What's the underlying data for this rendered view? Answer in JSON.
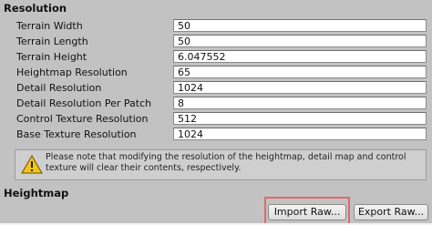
{
  "resolution": {
    "title": "Resolution",
    "rows": [
      {
        "label": "Terrain Width",
        "value": "50"
      },
      {
        "label": "Terrain Length",
        "value": "50"
      },
      {
        "label": "Terrain Height",
        "value": "6.047552"
      },
      {
        "label": "Heightmap Resolution",
        "value": "65"
      },
      {
        "label": "Detail Resolution",
        "value": "1024"
      },
      {
        "label": "Detail Resolution Per Patch",
        "value": "8"
      },
      {
        "label": "Control Texture Resolution",
        "value": "512"
      },
      {
        "label": "Base Texture Resolution",
        "value": "1024"
      }
    ],
    "warning": "Please note that modifying the resolution of the heightmap, detail map and control texture will clear their contents, respectively.",
    "warning_icon": "warning-triangle-icon"
  },
  "heightmap": {
    "title": "Heightmap",
    "import_label": "Import Raw...",
    "export_label": "Export Raw..."
  },
  "colors": {
    "panel_bg": "#c2c2c2",
    "highlight": "#e06a6a",
    "warning_yellow": "#f2c318"
  }
}
